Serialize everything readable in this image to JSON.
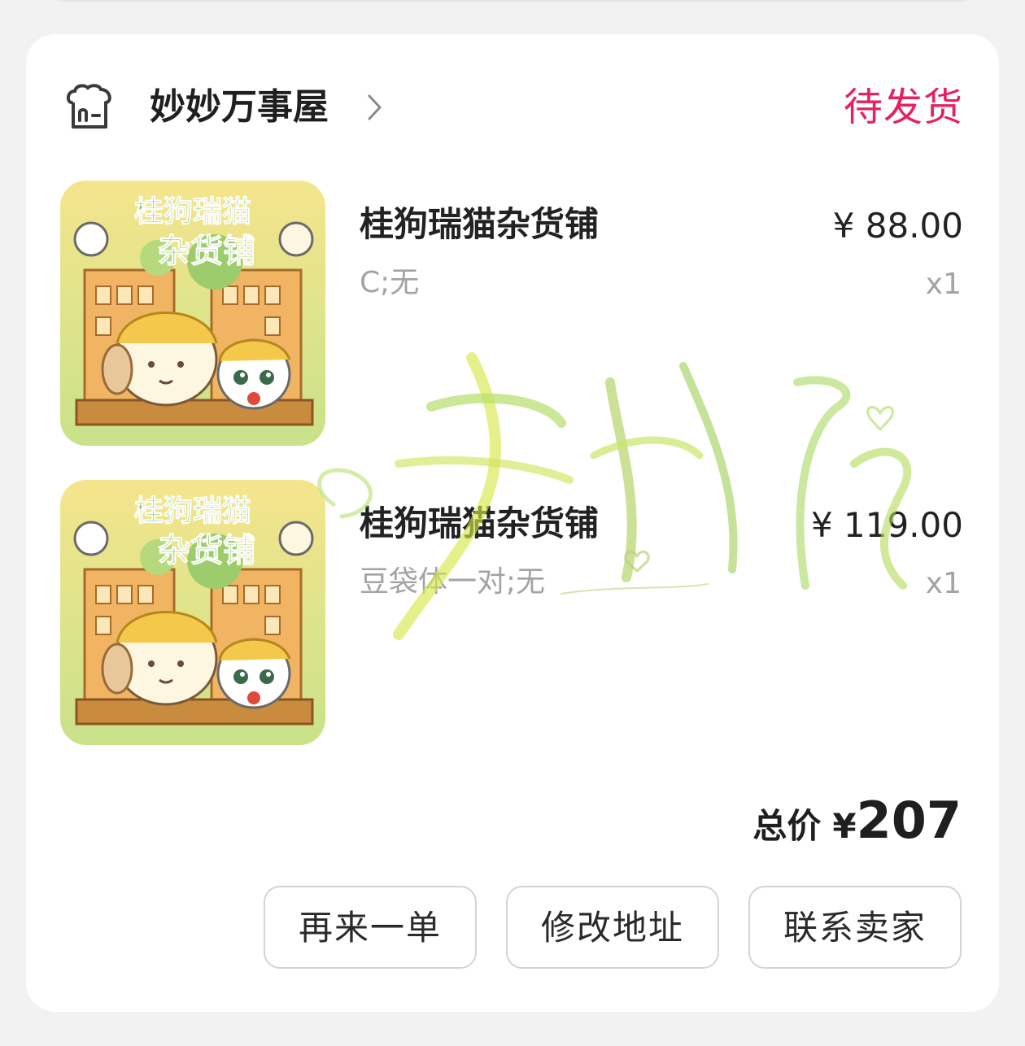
{
  "shop": {
    "name": "妙妙万事屋",
    "order_status": "待发货",
    "status_color": "#e6215d"
  },
  "items": [
    {
      "title": "桂狗瑞猫杂货铺",
      "spec": "C;无",
      "price": "¥ 88.00",
      "quantity": "x1",
      "image_title_line1": "桂狗瑞猫",
      "image_title_line2": "杂货铺"
    },
    {
      "title": "桂狗瑞猫杂货铺",
      "spec": "豆袋体一对;无",
      "price": "¥ 119.00",
      "quantity": "x1",
      "image_title_line1": "桂狗瑞猫",
      "image_title_line2": "杂货铺"
    }
  ],
  "total": {
    "label": "总价",
    "currency": "¥",
    "amount": "207"
  },
  "actions": {
    "reorder": "再来一单",
    "change_address": "修改地址",
    "contact_seller": "联系卖家"
  },
  "icons": {
    "shop": "shop-icon",
    "chevron": "chevron-right-icon"
  }
}
